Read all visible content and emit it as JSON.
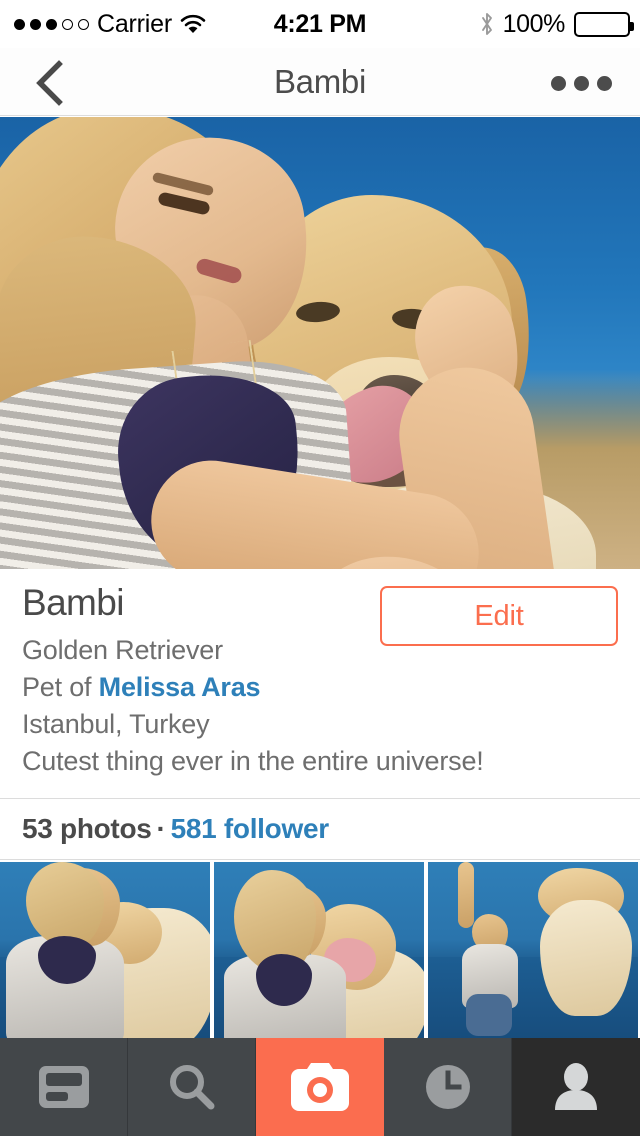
{
  "status_bar": {
    "signal_dots_filled": 3,
    "signal_dots_total": 5,
    "carrier": "Carrier",
    "wifi_icon": "wifi-icon",
    "time": "4:21 PM",
    "bluetooth_icon": "bluetooth-icon",
    "battery_percent": "100%",
    "battery_icon": "battery-full-icon"
  },
  "nav_bar": {
    "back_icon": "chevron-left-icon",
    "title": "Bambi",
    "more_icon": "more-options-icon"
  },
  "hero": {
    "alt": "Woman hugging a golden retriever at the beach"
  },
  "profile": {
    "name": "Bambi",
    "breed": "Golden Retriever",
    "owner_prefix": "Pet of ",
    "owner_name": "Melissa Aras",
    "location": "Istanbul, Turkey",
    "bio": "Cutest thing ever in the entire universe!",
    "edit_label": "Edit"
  },
  "stats": {
    "photos": "53 photos",
    "separator": "·",
    "followers": "581 follower"
  },
  "thumbnails": [
    {
      "alt": "Woman hugging puppy on the beach"
    },
    {
      "alt": "Woman holding golden retriever licking nose"
    },
    {
      "alt": "Woman playing with jumping golden retriever"
    }
  ],
  "tabbar": {
    "items": [
      {
        "name": "feed",
        "icon": "feed-icon",
        "active": false
      },
      {
        "name": "search",
        "icon": "search-icon",
        "active": false
      },
      {
        "name": "camera",
        "icon": "camera-icon",
        "active": false
      },
      {
        "name": "activity",
        "icon": "clock-icon",
        "active": false
      },
      {
        "name": "profile",
        "icon": "person-icon",
        "active": true
      }
    ]
  },
  "colors": {
    "accent": "#fb6d4f",
    "link": "#2e80b9",
    "tabbar_bg": "#43474a",
    "tab_active_bg": "#2b2b2b",
    "text_primary": "#4a4a4a",
    "text_secondary": "#6e6e6e"
  }
}
